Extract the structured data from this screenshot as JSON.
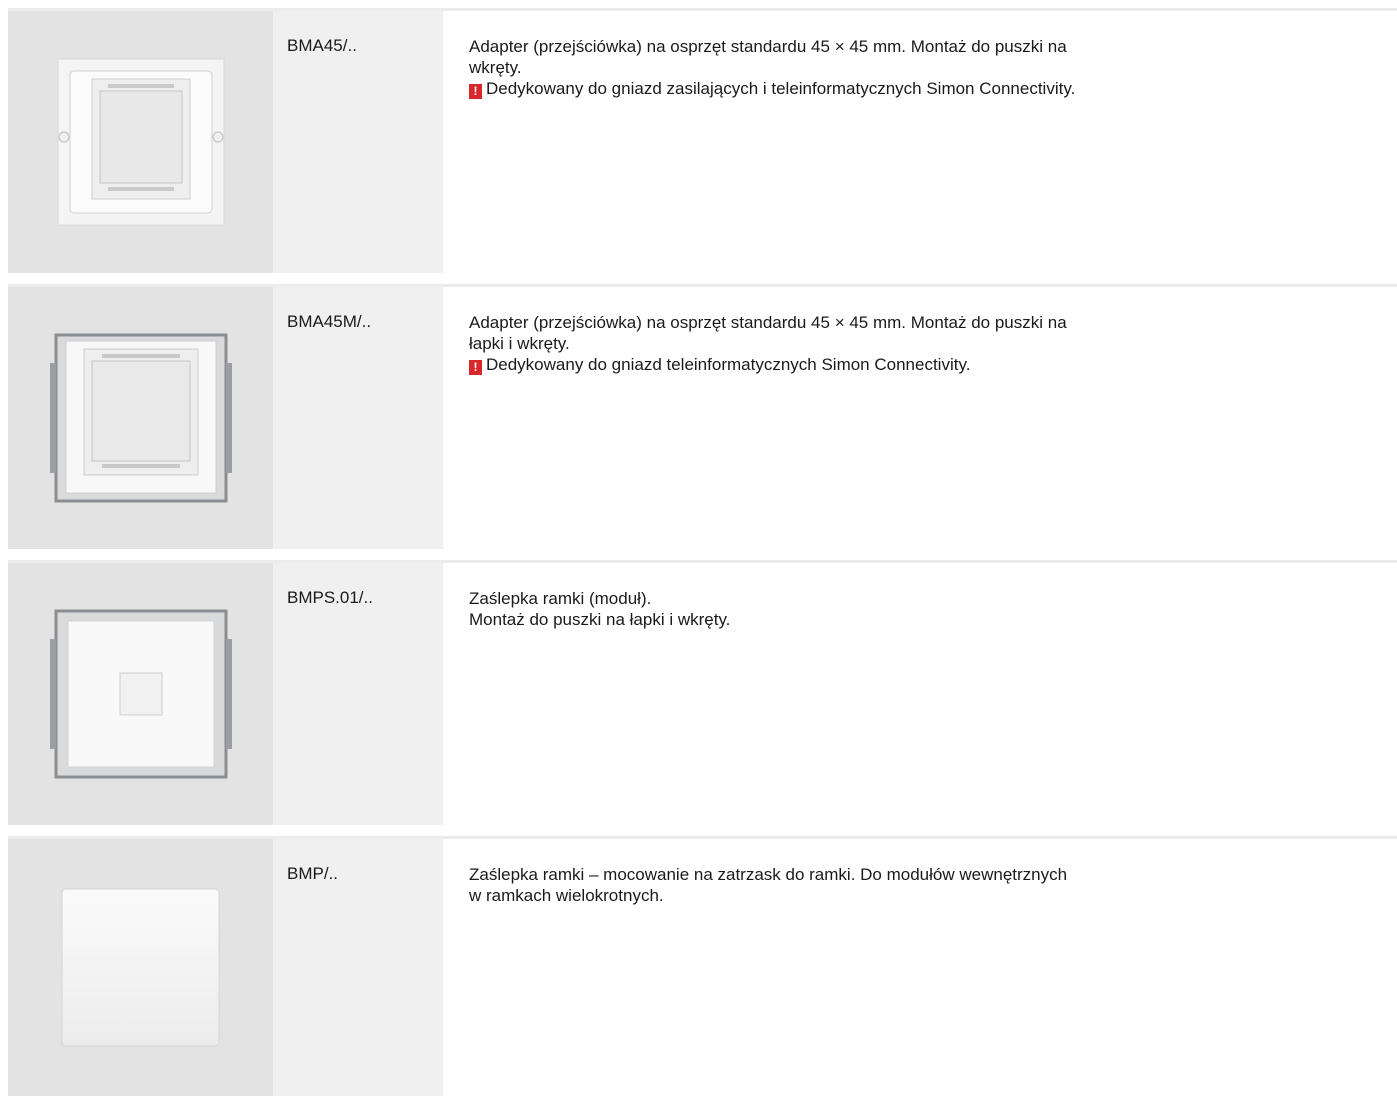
{
  "products": [
    {
      "code": "BMA45/..",
      "image": "adapter-frame-image",
      "lines": [
        "Adapter (przejściówka) na osprzęt standardu 45 × 45 mm. Montaż do puszki na",
        "wkręty."
      ],
      "warning": "Dedykowany do gniazd zasilających i teleinformatycznych Simon Connectivity."
    },
    {
      "code": "BMA45M/..",
      "image": "adapter-claw-frame-image",
      "lines": [
        "Adapter (przejściówka) na osprzęt standardu 45 × 45 mm. Montaż do puszki na",
        "łapki i wkręty."
      ],
      "warning": "Dedykowany do gniazd teleinformatycznych Simon Connectivity."
    },
    {
      "code": "BMPS.01/..",
      "image": "blank-module-claws-image",
      "lines": [
        "Zaślepka ramki (moduł).",
        "Montaż  do puszki na łapki i wkręty."
      ],
      "warning": null
    },
    {
      "code": "BMP/..",
      "image": "blank-plate-image",
      "lines": [
        "Zaślepka ramki – mocowanie na zatrzask do ramki. Do modułów wewnętrznych",
        "w ramkach wielokrotnych."
      ],
      "warning": null
    }
  ],
  "warning_icon": "exclamation-icon",
  "colors": {
    "warning": "#d8282b",
    "image_bg": "#e3e3e3",
    "code_bg": "#f0f0f0"
  }
}
